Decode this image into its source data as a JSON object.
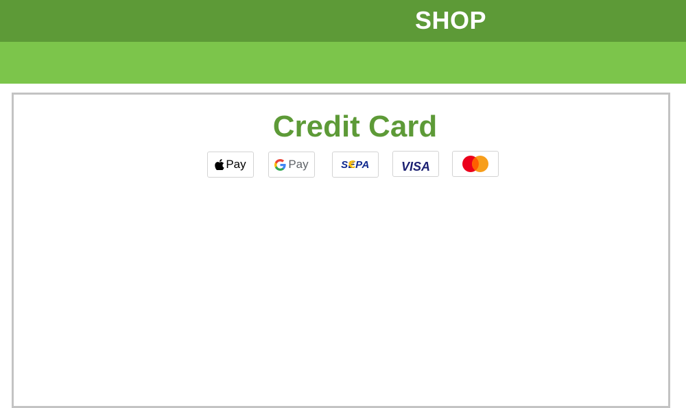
{
  "header": {
    "title": "SHOP"
  },
  "panel": {
    "title": "Credit Card",
    "payment_methods": [
      {
        "name": "apple-pay",
        "label": "Pay"
      },
      {
        "name": "google-pay",
        "label": "Pay"
      },
      {
        "name": "sepa",
        "label": "SEPA"
      },
      {
        "name": "visa",
        "label": "VISA"
      },
      {
        "name": "mastercard",
        "label": ""
      }
    ]
  },
  "colors": {
    "header_dark_green": "#5d9a37",
    "header_light_green": "#7cc54b",
    "title_green": "#5d9a37",
    "panel_border": "#c3c3c3",
    "sepa_blue": "#10298e",
    "sepa_yellow": "#ffbe00",
    "visa_blue": "#1a1f71",
    "mastercard_red": "#eb001b",
    "mastercard_orange": "#f79e1b"
  }
}
